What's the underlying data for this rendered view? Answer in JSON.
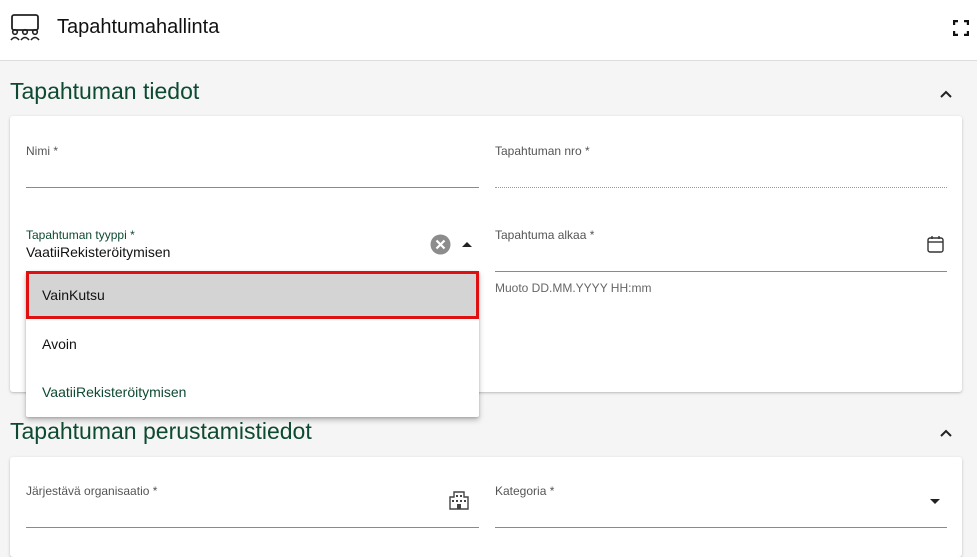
{
  "app": {
    "title": "Tapahtumahallinta",
    "icon": "people-group-icon",
    "fullscreen_icon": "fullscreen-icon"
  },
  "section1": {
    "title": "Tapahtuman tiedot",
    "fields": {
      "name_label": "Nimi *",
      "number_label": "Tapahtuman nro *",
      "type_label": "Tapahtuman tyyppi *",
      "type_value": "VaatiiRekisteröitymisen",
      "start_label": "Tapahtuma alkaa *",
      "start_hint": "Muoto DD.MM.YYYY HH:mm"
    },
    "type_options": [
      "VainKutsu",
      "Avoin",
      "VaatiiRekisteröitymisen"
    ]
  },
  "section2": {
    "title": "Tapahtuman perustamistiedot",
    "fields": {
      "org_label": "Järjestävä organisaatio *",
      "category_label": "Kategoria *"
    }
  },
  "colors": {
    "accent": "#0e4a32",
    "highlight_border": "#e01010",
    "highlight_bg": "#d4d4d4"
  }
}
